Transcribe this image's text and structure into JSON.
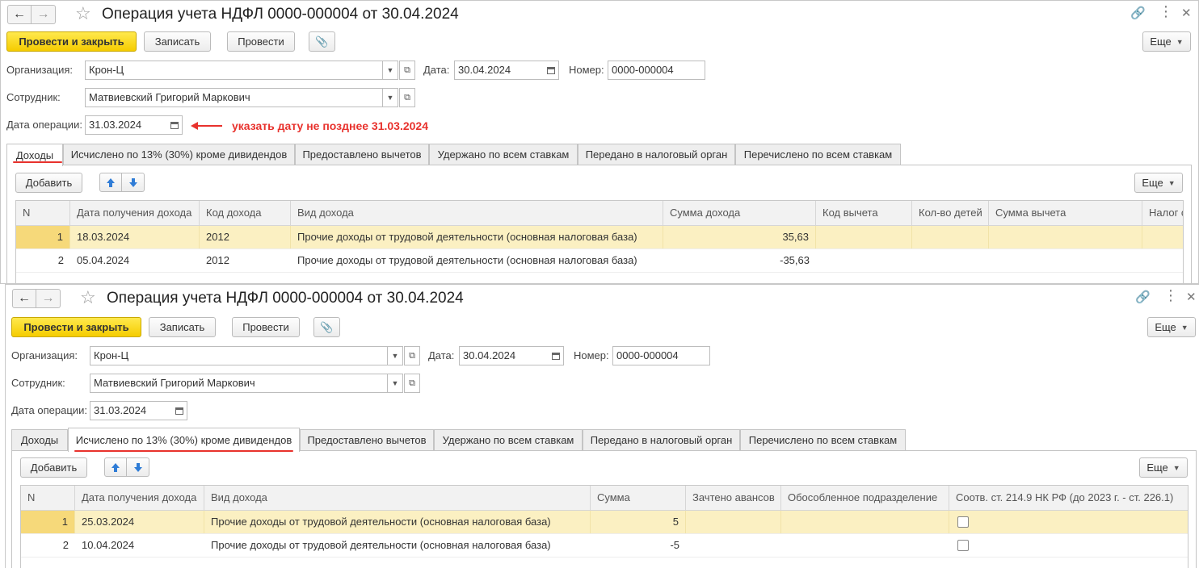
{
  "form_top": {
    "title": "Операция учета НДФЛ 0000-000004 от 30.04.2024",
    "toolbar": {
      "post_close": "Провести и закрыть",
      "save": "Записать",
      "post": "Провести",
      "more": "Еще"
    },
    "org_label": "Организация:",
    "org_value": "Крон-Ц",
    "date_label": "Дата:",
    "date_value": "30.04.2024",
    "number_label": "Номер:",
    "number_value": "0000-000004",
    "employee_label": "Сотрудник:",
    "employee_value": "Матвиевский Григорий Маркович",
    "opdate_label": "Дата операции:",
    "opdate_value": "31.03.2024",
    "annotation": "указать дату не позднее 31.03.2024",
    "tabs": [
      "Доходы",
      "Исчислено по 13% (30%) кроме дивидендов",
      "Предоставлено вычетов",
      "Удержано по всем ставкам",
      "Передано в налоговый орган",
      "Перечислено по всем ставкам"
    ],
    "active_tab": 0,
    "add_label": "Добавить",
    "more_label": "Еще",
    "columns": [
      "N",
      "Дата получения дохода",
      "Код дохода",
      "Вид дохода",
      "Сумма дохода",
      "Код вычета",
      "Кол-во детей",
      "Сумма вычета",
      "Налог с"
    ],
    "rows": [
      {
        "n": "1",
        "date": "18.03.2024",
        "code": "2012",
        "kind": "Прочие доходы от трудовой деятельности (основная налоговая база)",
        "sum": "35,63"
      },
      {
        "n": "2",
        "date": "05.04.2024",
        "code": "2012",
        "kind": "Прочие доходы от трудовой деятельности (основная налоговая база)",
        "sum": "-35,63"
      }
    ]
  },
  "form_bottom": {
    "title": "Операция учета НДФЛ 0000-000004 от 30.04.2024",
    "toolbar": {
      "post_close": "Провести и закрыть",
      "save": "Записать",
      "post": "Провести",
      "more": "Еще"
    },
    "org_label": "Организация:",
    "org_value": "Крон-Ц",
    "date_label": "Дата:",
    "date_value": "30.04.2024",
    "number_label": "Номер:",
    "number_value": "0000-000004",
    "employee_label": "Сотрудник:",
    "employee_value": "Матвиевский Григорий Маркович",
    "opdate_label": "Дата операции:",
    "opdate_value": "31.03.2024",
    "tabs": [
      "Доходы",
      "Исчислено по 13% (30%) кроме дивидендов",
      "Предоставлено вычетов",
      "Удержано по всем ставкам",
      "Передано в налоговый орган",
      "Перечислено по всем ставкам"
    ],
    "active_tab": 1,
    "add_label": "Добавить",
    "more_label": "Еще",
    "columns": [
      "N",
      "Дата получения дохода",
      "Вид дохода",
      "Сумма",
      "Зачтено авансов",
      "Обособленное подразделение",
      "Соотв. ст. 214.9 НК РФ (до 2023 г. - ст. 226.1)"
    ],
    "rows": [
      {
        "n": "1",
        "date": "25.03.2024",
        "kind": "Прочие доходы от трудовой деятельности (основная налоговая база)",
        "sum": "5",
        "checked": false
      },
      {
        "n": "2",
        "date": "10.04.2024",
        "kind": "Прочие доходы от трудовой деятельности (основная налоговая база)",
        "sum": "-5",
        "checked": false
      }
    ]
  },
  "colors": {
    "primary_button": "#f5cc00",
    "annotation": "#e8322d",
    "selected_row": "#fbf0c2",
    "current_cell": "#f6d97a",
    "arrow_icon": "#2f7cd6"
  }
}
